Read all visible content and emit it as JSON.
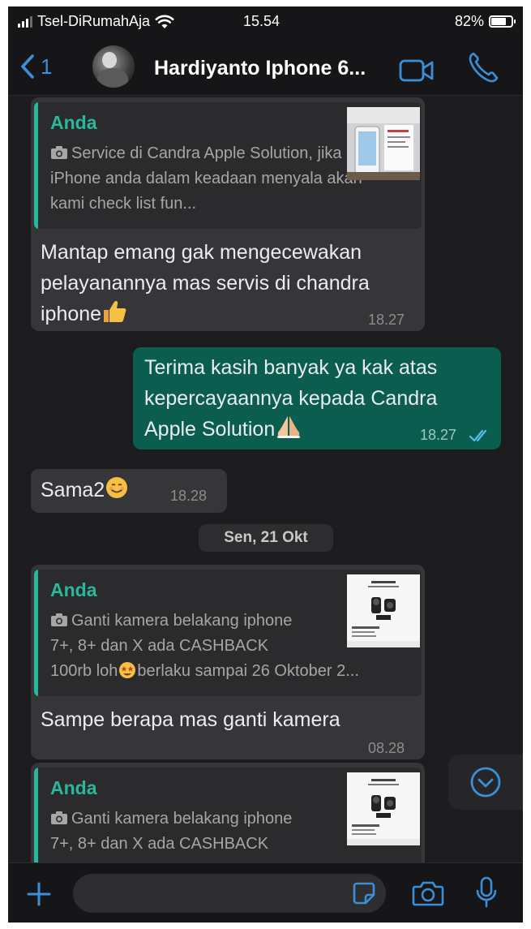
{
  "status_bar": {
    "carrier": "Tsel-DiRumahAja",
    "time": "15.54",
    "battery": "82%",
    "battery_level": 0.82,
    "signal_bars_active": 3,
    "signal_bars_total": 4
  },
  "header": {
    "back_count": "1",
    "contact_name": "Hardiyanto Iphone 6...",
    "accent_color": "#3a8fd9"
  },
  "messages": [
    {
      "direction": "incoming",
      "quote": {
        "author": "Anda",
        "text": "Service di Candra Apple Solution, jika iPhone anda dalam keadaan menyala akan kami check list fun..."
      },
      "text": "Mantap emang gak mengecewakan pelayanannya mas servis di chandra iphone",
      "emoji": "thumbs-up",
      "time": "18.27"
    },
    {
      "direction": "outgoing",
      "text": "Terima kasih banyak ya kak atas kepercayaannya kepada Candra Apple Solution",
      "emoji": "folded-hands",
      "time": "18.27",
      "read": true
    },
    {
      "direction": "incoming",
      "text": "Sama2",
      "emoji": "smiling-face",
      "time": "18.28"
    },
    {
      "direction": "incoming",
      "quote": {
        "author": "Anda",
        "text_line1": "Ganti kamera belakang iphone",
        "text_line2": "7+, 8+ dan X ada CASHBACK",
        "text_line3a": "100rb loh",
        "text_line3b": "berlaku sampai 26 Oktober 2..."
      },
      "text": "Sampe berapa mas ganti kamera",
      "time": "08.28"
    },
    {
      "direction": "incoming",
      "quote": {
        "author": "Anda",
        "text_line1": "Ganti kamera belakang iphone",
        "text_line2": "7+, 8+ dan X ada CASHBACK"
      }
    }
  ],
  "date_separator": "Sen, 21 Okt",
  "colors": {
    "outgoing_bubble": "#0b5e4f",
    "incoming_bubble": "#363638",
    "quote_accent": "#2ab79c"
  },
  "icons": {
    "back": "chevron-left-icon",
    "video": "video-camera-icon",
    "phone": "phone-icon",
    "scroll": "chevron-down-circle-icon",
    "attach": "plus-icon",
    "sticker": "sticker-icon",
    "camera": "camera-icon",
    "mic": "microphone-icon"
  }
}
